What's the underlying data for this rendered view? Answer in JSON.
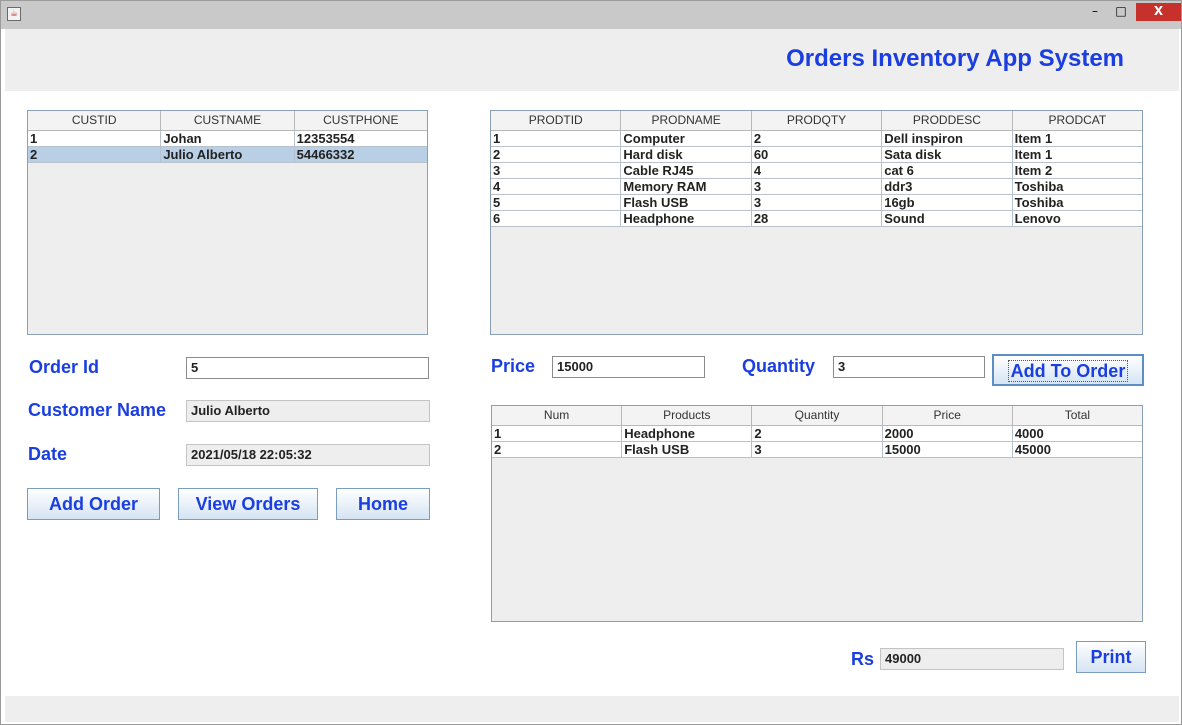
{
  "app": {
    "title": "Orders Inventory App System",
    "icon": "java-cup-icon"
  },
  "window_controls": {
    "minimize": "–",
    "maximize": "□",
    "close": "X"
  },
  "customers_table": {
    "columns": [
      "CUSTID",
      "CUSTNAME",
      "CUSTPHONE"
    ],
    "rows": [
      [
        "1",
        "Johan",
        "12353554"
      ],
      [
        "2",
        "Julio Alberto",
        "54466332"
      ]
    ],
    "selected_row": 1
  },
  "products_table": {
    "columns": [
      "PRODTID",
      "PRODNAME",
      "PRODQTY",
      "PRODDESC",
      "PRODCAT"
    ],
    "rows": [
      [
        "1",
        "Computer",
        "2",
        "Dell inspiron",
        "Item 1"
      ],
      [
        "2",
        "Hard disk",
        "60",
        "Sata disk",
        "Item 1"
      ],
      [
        "3",
        "Cable RJ45",
        "4",
        "cat 6",
        "Item 2"
      ],
      [
        "4",
        "Memory RAM",
        "3",
        "ddr3",
        "Toshiba"
      ],
      [
        "5",
        "Flash USB",
        "3",
        "16gb",
        "Toshiba"
      ],
      [
        "6",
        "Headphone",
        "28",
        "Sound",
        "Lenovo"
      ]
    ]
  },
  "order_form": {
    "order_id_label": "Order Id",
    "order_id_value": "5",
    "customer_name_label": "Customer Name",
    "customer_name_value": "Julio Alberto",
    "date_label": "Date",
    "date_value": "2021/05/18 22:05:32"
  },
  "order_buttons": {
    "add_order": "Add Order",
    "view_orders": "View Orders",
    "home": "Home"
  },
  "item_form": {
    "price_label": "Price",
    "price_value": "15000",
    "quantity_label": "Quantity",
    "quantity_value": "3",
    "add_to_order": "Add To Order"
  },
  "order_items_table": {
    "columns": [
      "Num",
      "Products",
      "Quantity",
      "Price",
      "Total"
    ],
    "rows": [
      [
        "1",
        "Headphone",
        "2",
        "2000",
        "4000"
      ],
      [
        "2",
        "Flash USB",
        "3",
        "15000",
        "45000"
      ]
    ]
  },
  "totals": {
    "currency_label": "Rs",
    "total_value": "49000",
    "print": "Print"
  },
  "colors": {
    "accent": "#1a3ee0",
    "selection": "#b8cfe5",
    "panel": "#eeeeee"
  }
}
